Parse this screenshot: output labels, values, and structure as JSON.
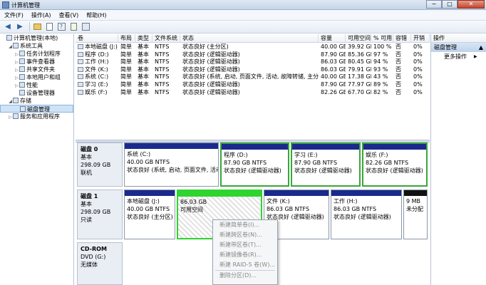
{
  "window": {
    "title": "计算机管理"
  },
  "menu": [
    "文件(F)",
    "操作(A)",
    "查看(V)",
    "帮助(H)"
  ],
  "toolbar": {
    "icons": [
      "back-arrow-icon",
      "forward-arrow-icon",
      "folder-up-icon",
      "properties-icon",
      "help-icon",
      "export-icon",
      "refresh-icon"
    ]
  },
  "tree": [
    {
      "label": "计算机管理(本地)",
      "level": 0,
      "expander": ""
    },
    {
      "label": "系统工具",
      "level": 1,
      "expander": "◢"
    },
    {
      "label": "任务计划程序",
      "level": 2,
      "expander": "▷"
    },
    {
      "label": "事件查看器",
      "level": 2,
      "expander": "▷"
    },
    {
      "label": "共享文件夹",
      "level": 2,
      "expander": "▷"
    },
    {
      "label": "本地用户和组",
      "level": 2,
      "expander": "▷"
    },
    {
      "label": "性能",
      "level": 2,
      "expander": "▷"
    },
    {
      "label": "设备管理器",
      "level": 2,
      "expander": ""
    },
    {
      "label": "存储",
      "level": 1,
      "expander": "◢"
    },
    {
      "label": "磁盘管理",
      "level": 2,
      "expander": "",
      "selected": true
    },
    {
      "label": "服务和应用程序",
      "level": 1,
      "expander": "▷"
    }
  ],
  "volume_table": {
    "columns": [
      "卷",
      "布局",
      "类型",
      "文件系统",
      "状态",
      "容量",
      "可用空间",
      "% 可用",
      "容错",
      "开销"
    ],
    "rows": [
      [
        "本地磁盘 (J:)",
        "简单",
        "基本",
        "NTFS",
        "状态良好 (主分区)",
        "40.00 GB",
        "39.92 GB",
        "100 %",
        "否",
        "0%"
      ],
      [
        "程序 (D:)",
        "简单",
        "基本",
        "NTFS",
        "状态良好 (逻辑驱动器)",
        "87.90 GB",
        "85.36 GB",
        "97 %",
        "否",
        "0%"
      ],
      [
        "工作 (H:)",
        "简单",
        "基本",
        "NTFS",
        "状态良好 (逻辑驱动器)",
        "86.03 GB",
        "80.45 GB",
        "94 %",
        "否",
        "0%"
      ],
      [
        "文件 (K:)",
        "简单",
        "基本",
        "NTFS",
        "状态良好 (逻辑驱动器)",
        "86.03 GB",
        "79.91 GB",
        "93 %",
        "否",
        "0%"
      ],
      [
        "系统 (C:)",
        "简单",
        "基本",
        "NTFS",
        "状态良好 (系统, 启动, 页面文件, 活动, 故障转储, 主分区)",
        "40.00 GB",
        "17.38 GB",
        "43 %",
        "否",
        "0%"
      ],
      [
        "学习 (E:)",
        "简单",
        "基本",
        "NTFS",
        "状态良好 (逻辑驱动器)",
        "87.90 GB",
        "77.97 GB",
        "89 %",
        "否",
        "0%"
      ],
      [
        "娱乐 (F:)",
        "简单",
        "基本",
        "NTFS",
        "状态良好 (逻辑驱动器)",
        "82.26 GB",
        "67.70 GB",
        "82 %",
        "否",
        "0%"
      ]
    ]
  },
  "disks": [
    {
      "name": "磁盘 0",
      "type": "基本",
      "size": "298.09 GB",
      "status": "联机",
      "partitions": [
        {
          "name": "系统 (C:)",
          "size": "40.00 GB NTFS",
          "status": "状态良好 (系统, 启动, 页面文件, 活动, 故障转储, 主分区)",
          "bar": "#1a2a8c"
        },
        {
          "name": "程序 (D:)",
          "size": "87.90 GB NTFS",
          "status": "状态良好 (逻辑驱动器)",
          "bar": "#1a2a8c"
        },
        {
          "name": "学习 (E:)",
          "size": "87.90 GB NTFS",
          "status": "状态良好 (逻辑驱动器)",
          "bar": "#1a2a8c"
        },
        {
          "name": "娱乐 (F:)",
          "size": "82.26 GB NTFS",
          "status": "状态良好 (逻辑驱动器)",
          "bar": "#1a2a8c"
        }
      ]
    },
    {
      "name": "磁盘 1",
      "type": "基本",
      "size": "298.09 GB",
      "status": "只读",
      "partitions": [
        {
          "name": "本地磁盘 (J:)",
          "size": "40.00 GB NTFS",
          "status": "状态良好 (主分区)",
          "bar": "#1a2a8c"
        },
        {
          "name": "",
          "size": "86.03 GB",
          "status": "可用空间",
          "bar": "#2fd42f"
        },
        {
          "name": "文件 (K:)",
          "size": "86.03 GB NTFS",
          "status": "状态良好 (逻辑驱动器)",
          "bar": "#1a2a8c"
        },
        {
          "name": "工作 (H:)",
          "size": "86.03 GB NTFS",
          "status": "状态良好 (逻辑驱动器)",
          "bar": "#1a2a8c"
        },
        {
          "name": "",
          "size": "9 MB",
          "status": "未分配",
          "bar": "#111111"
        }
      ]
    },
    {
      "name": "CD-ROM",
      "type": "DVD (G:)",
      "size": "",
      "status": "无媒体"
    }
  ],
  "actions": {
    "header": "操作",
    "section": "磁盘管理",
    "more": "更多操作"
  },
  "context_menu": [
    "新建简单卷(I)...",
    "新建跨区卷(N)...",
    "新建带区卷(T)...",
    "新建镜像卷(R)...",
    "新建 RAID-5 卷(W)...",
    "删除分区(D)..."
  ]
}
